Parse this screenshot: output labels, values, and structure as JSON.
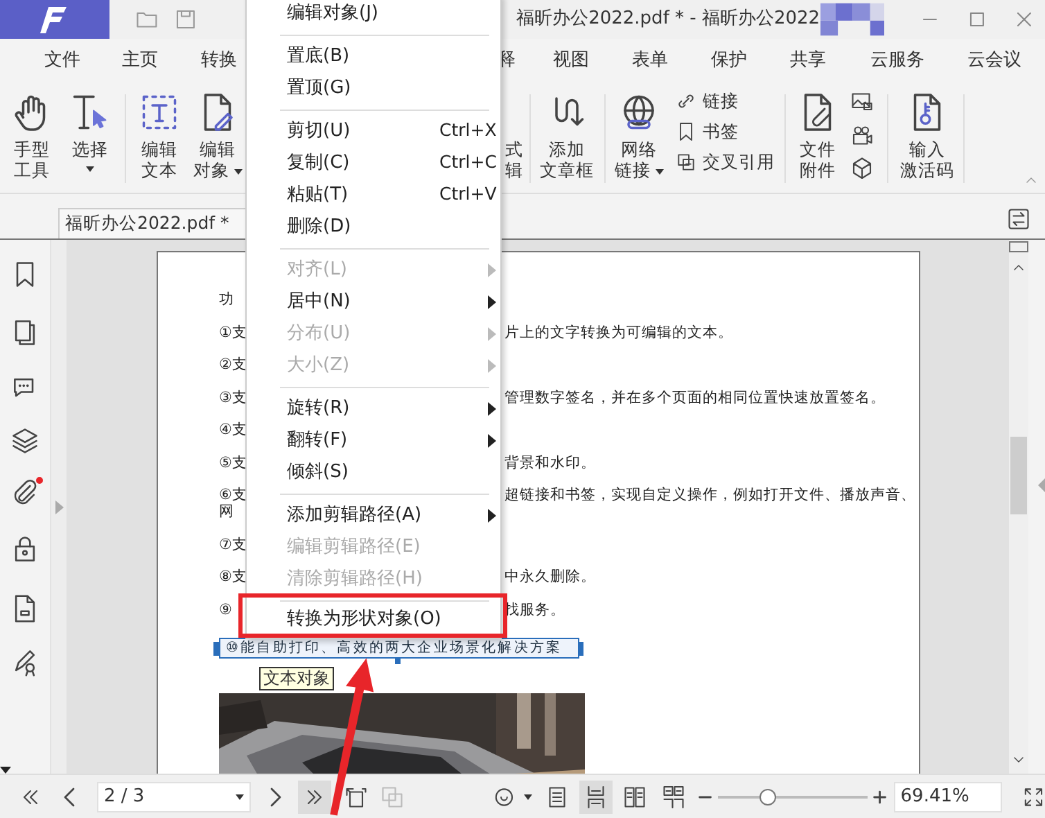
{
  "title_bar": {
    "title": "福昕办公2022.pdf * - 福昕办公2022"
  },
  "ribbon_tabs": [
    {
      "label": "文件"
    },
    {
      "label": "主页"
    },
    {
      "label": "转换"
    },
    {
      "label": "释"
    },
    {
      "label": "视图"
    },
    {
      "label": "表单"
    },
    {
      "label": "保护"
    },
    {
      "label": "共享"
    },
    {
      "label": "云服务"
    },
    {
      "label": "云会议"
    }
  ],
  "ribbon": [
    {
      "kind": "hand",
      "lines": [
        "手型",
        "工具"
      ],
      "dropdown": false
    },
    {
      "kind": "select",
      "lines": [
        "选择"
      ],
      "dropdown": true
    },
    {
      "kind": "edit_text",
      "lines": [
        "编辑",
        "文本"
      ],
      "dropdown": false
    },
    {
      "kind": "edit_object",
      "lines": [
        "编辑",
        "对象"
      ],
      "dropdown": true
    },
    {
      "kind": "partial",
      "lines": [
        "式",
        "辑"
      ],
      "dropdown": false
    },
    {
      "kind": "article",
      "lines": [
        "添加",
        "文章框"
      ],
      "dropdown": false
    },
    {
      "kind": "weblink",
      "lines": [
        "网络",
        "链接"
      ],
      "dropdown": true
    },
    {
      "kind": "list",
      "items": [
        {
          "kind": "link",
          "label": "链接"
        },
        {
          "kind": "bookmark",
          "label": "书签"
        },
        {
          "kind": "crossref",
          "label": "交叉引用"
        }
      ]
    },
    {
      "kind": "attach",
      "lines": [
        "文件",
        "附件"
      ],
      "dropdown": false
    },
    {
      "kind": "media"
    },
    {
      "kind": "key",
      "lines": [
        "输入",
        "激活码"
      ],
      "dropdown": false
    }
  ],
  "document_tab": "福昕办公2022.pdf *",
  "sidebar": [
    {
      "kind": "bookmark",
      "badge": false
    },
    {
      "kind": "pages",
      "badge": false
    },
    {
      "kind": "comments",
      "badge": false
    },
    {
      "kind": "layers",
      "badge": false
    },
    {
      "kind": "attachments",
      "badge": true
    },
    {
      "kind": "security",
      "badge": false
    },
    {
      "kind": "document",
      "badge": false
    },
    {
      "kind": "signature",
      "badge": false
    }
  ],
  "page_lines": [
    {
      "kind": "line",
      "left": "功"
    },
    {
      "kind": "line",
      "left": "①支",
      "right": "片上的文字转换为可编辑的文本。"
    },
    {
      "kind": "line",
      "left": "②支"
    },
    {
      "kind": "line",
      "left": "③支",
      "right": "管理数字签名，并在多个页面的相同位置快速放置签名。"
    },
    {
      "kind": "line",
      "left": "④支"
    },
    {
      "kind": "line",
      "left": "⑤支",
      "right": "背景和水印。"
    },
    {
      "kind": "line",
      "left": "⑥支",
      "right": "超链接和书签，实现自定义操作，例如打开文件、播放声音、"
    },
    {
      "kind": "wrap",
      "left": "网"
    },
    {
      "kind": "line",
      "left": "⑦支"
    },
    {
      "kind": "line",
      "left": "⑧支",
      "right": "中永久删除。"
    },
    {
      "kind": "line",
      "left": "⑨",
      "right": "找服务。"
    },
    {
      "kind": "selected",
      "left": "⑩能自助打印、高效的两大企业场景化解决方案",
      "tooltip": "文本对象"
    }
  ],
  "context_menu": [
    {
      "kind": "item",
      "label": "编辑对象(J)",
      "disabled": false,
      "submenu": false,
      "annotated": false
    },
    {
      "kind": "separator"
    },
    {
      "kind": "item",
      "label": "置底(B)",
      "disabled": false,
      "submenu": false,
      "annotated": false
    },
    {
      "kind": "item",
      "label": "置顶(G)",
      "disabled": false,
      "submenu": false,
      "annotated": false
    },
    {
      "kind": "separator"
    },
    {
      "kind": "item",
      "label": "剪切(U)",
      "shortcut": "Ctrl+X",
      "disabled": false,
      "submenu": false,
      "annotated": false
    },
    {
      "kind": "item",
      "label": "复制(C)",
      "shortcut": "Ctrl+C",
      "disabled": false,
      "submenu": false,
      "annotated": false
    },
    {
      "kind": "item",
      "label": "粘贴(T)",
      "shortcut": "Ctrl+V",
      "disabled": false,
      "submenu": false,
      "annotated": false
    },
    {
      "kind": "item",
      "label": "删除(D)",
      "disabled": false,
      "submenu": false,
      "annotated": false
    },
    {
      "kind": "separator"
    },
    {
      "kind": "item",
      "label": "对齐(L)",
      "disabled": true,
      "submenu": true,
      "annotated": false
    },
    {
      "kind": "item",
      "label": "居中(N)",
      "disabled": false,
      "submenu": true,
      "annotated": false
    },
    {
      "kind": "item",
      "label": "分布(U)",
      "disabled": true,
      "submenu": true,
      "annotated": false
    },
    {
      "kind": "item",
      "label": "大小(Z)",
      "disabled": true,
      "submenu": true,
      "annotated": false
    },
    {
      "kind": "separator"
    },
    {
      "kind": "item",
      "label": "旋转(R)",
      "disabled": false,
      "submenu": true,
      "annotated": false
    },
    {
      "kind": "item",
      "label": "翻转(F)",
      "disabled": false,
      "submenu": true,
      "annotated": false
    },
    {
      "kind": "item",
      "label": "倾斜(S)",
      "disabled": false,
      "submenu": false,
      "annotated": false
    },
    {
      "kind": "separator"
    },
    {
      "kind": "item",
      "label": "添加剪辑路径(A)",
      "disabled": false,
      "submenu": true,
      "annotated": false
    },
    {
      "kind": "item",
      "label": "编辑剪辑路径(E)",
      "disabled": true,
      "submenu": false,
      "annotated": false
    },
    {
      "kind": "item",
      "label": "清除剪辑路径(H)",
      "disabled": true,
      "submenu": false,
      "annotated": false
    },
    {
      "kind": "separator"
    },
    {
      "kind": "item",
      "label": "转换为形状对象(O)",
      "disabled": false,
      "submenu": false,
      "annotated": true
    }
  ],
  "bottom_bar": {
    "nav_buttons": [
      {
        "kind": "first",
        "pressed": false,
        "disabled": false
      },
      {
        "kind": "prev",
        "pressed": false,
        "disabled": false
      },
      {
        "kind": "next",
        "pressed": false,
        "disabled": false
      },
      {
        "kind": "last",
        "pressed": true,
        "disabled": false
      },
      {
        "kind": "rotate",
        "pressed": false,
        "disabled": false
      },
      {
        "kind": "swap",
        "pressed": false,
        "disabled": true
      }
    ],
    "page_field": "2 / 3",
    "view_modes": [
      {
        "kind": "single",
        "selected": false
      },
      {
        "kind": "continuous",
        "selected": true
      },
      {
        "kind": "facing",
        "selected": false
      },
      {
        "kind": "facing_continuous",
        "selected": false
      }
    ],
    "zoom_slider": {
      "level": 0.33
    },
    "zoom_field": "69.41%"
  }
}
